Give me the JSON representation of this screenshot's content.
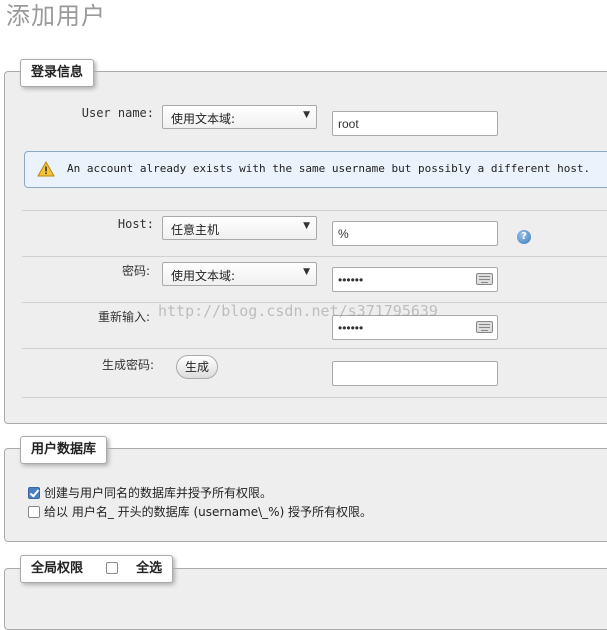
{
  "page": {
    "title": "添加用户"
  },
  "login_section": {
    "legend": "登录信息",
    "username": {
      "label": "User name:",
      "select_value": "使用文本域:",
      "input_value": "root"
    },
    "notice": {
      "icon": "warning-icon",
      "text": "An account already exists with the same username but possibly a different host."
    },
    "host": {
      "label": "Host:",
      "select_value": "任意主机",
      "input_value": "%",
      "help_icon": "help-icon",
      "help_glyph": "?"
    },
    "password": {
      "label": "密码:",
      "select_value": "使用文本域:",
      "input_value": "••••••"
    },
    "reenter": {
      "label": "重新输入:",
      "input_value": "••••••"
    },
    "generate": {
      "label": "生成密码:",
      "button_label": "生成",
      "input_value": ""
    }
  },
  "database_section": {
    "legend": "用户数据库",
    "options": [
      {
        "label": "创建与用户同名的数据库并授予所有权限。",
        "checked": true
      },
      {
        "label": "给以 用户名_ 开头的数据库 (username\\_%) 授予所有权限。",
        "checked": false
      }
    ]
  },
  "global_section": {
    "legend": "全局权限",
    "select_all_label": "全选",
    "select_all_checked": false
  },
  "watermark": "http://blog.csdn.net/s371795639",
  "colors": {
    "notice_bg": "#eaf3fb",
    "checkbox_checked": "#4c7fc0",
    "help_icon": "#3b78b8"
  }
}
